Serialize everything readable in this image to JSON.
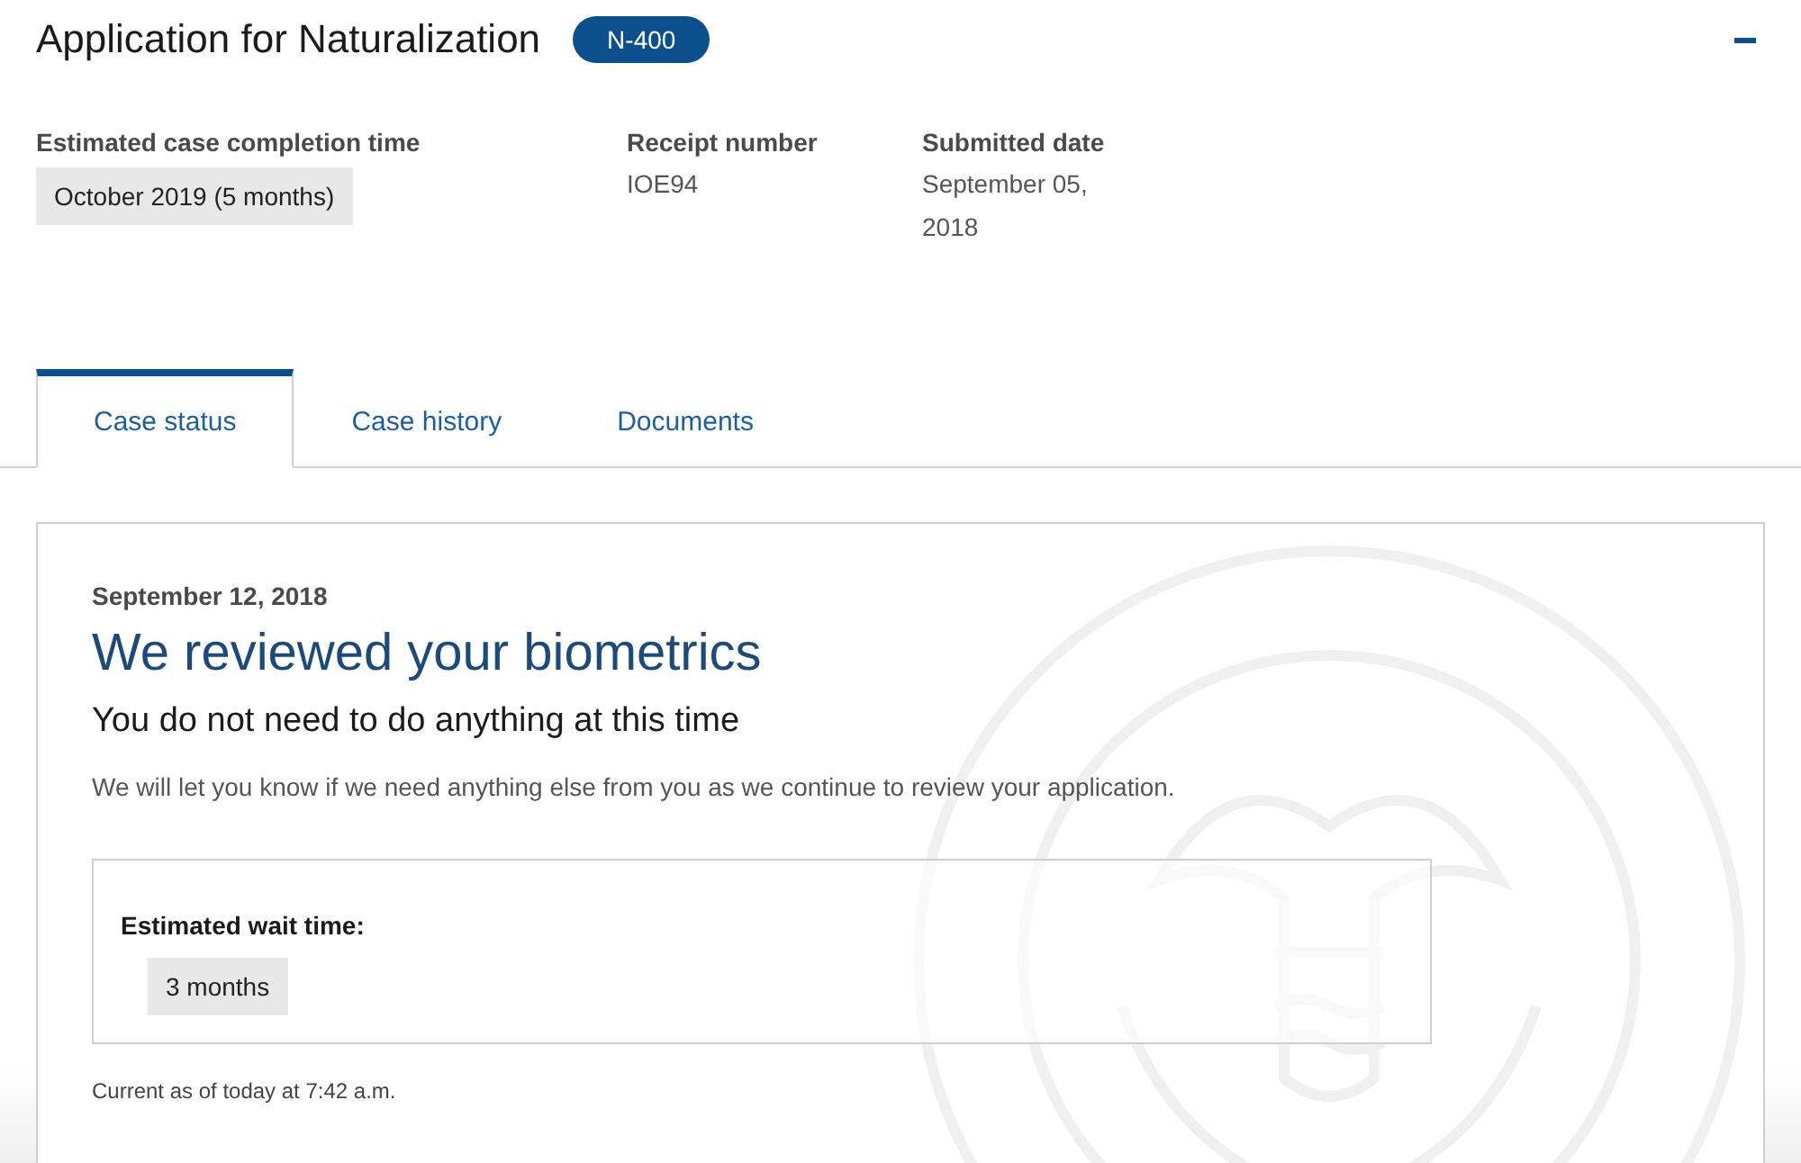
{
  "header": {
    "title": "Application for Naturalization",
    "form_badge": "N-400",
    "expanded": true
  },
  "fields": [
    {
      "label": "Estimated case completion time",
      "value": "October 2019 (5 months)",
      "kind": "chip"
    },
    {
      "label": "Receipt number",
      "value": "IOE94",
      "kind": "plain"
    },
    {
      "label": "Submitted date",
      "value": "September 05, 2018",
      "kind": "plain"
    }
  ],
  "tabs": [
    {
      "label": "Case status",
      "selected": true
    },
    {
      "label": "Case history",
      "selected": false
    },
    {
      "label": "Documents",
      "selected": false
    }
  ],
  "status": {
    "date": "September 12, 2018",
    "title": "We reviewed your biometrics",
    "subtitle": "You do not need to do anything at this time",
    "message": "We will let you know if we need anything else from you as we continue to review your application.",
    "wait": {
      "label": "Estimated wait time:",
      "value": "3 months"
    },
    "updated": "Current as of today at 7:42 a.m."
  }
}
